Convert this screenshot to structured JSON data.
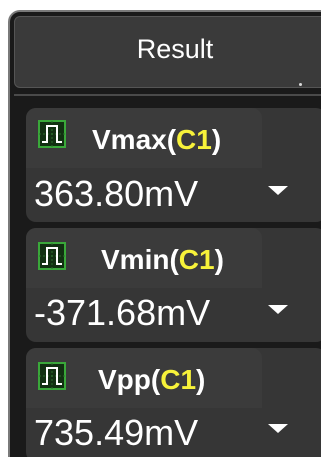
{
  "panel": {
    "title": "Result"
  },
  "measurements": [
    {
      "name": "Vmax",
      "open_paren": "(",
      "channel": "C1",
      "close_paren": ")",
      "value": "363.80mV"
    },
    {
      "name": "Vmin",
      "open_paren": "(",
      "channel": "C1",
      "close_paren": ")",
      "value": "-371.68mV"
    },
    {
      "name": "Vpp",
      "open_paren": "(",
      "channel": "C1",
      "close_paren": ")",
      "value": "735.49mV"
    }
  ],
  "icons": {
    "measurement": "pulse-waveform-icon",
    "dropdown": "triangle-down-icon"
  },
  "colors": {
    "panel_background": "#1a1a1a",
    "header_background": "#3a3a3a",
    "card_background": "#363636",
    "text": "#ffffff",
    "channel_c1": "#f7f23a",
    "icon_green": "#36a336"
  }
}
